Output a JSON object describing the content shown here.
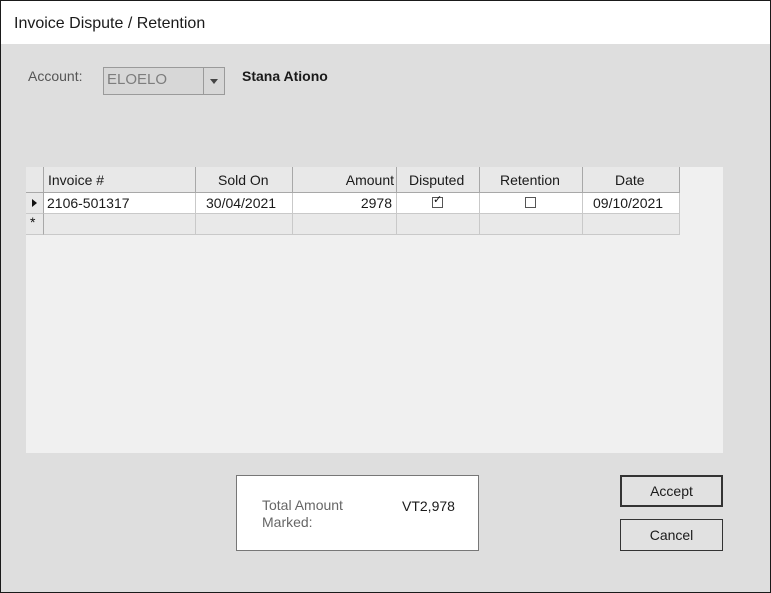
{
  "window": {
    "title": "Invoice Dispute / Retention"
  },
  "account": {
    "label": "Account:",
    "value": "ELOELO",
    "name": "Stana Ationo"
  },
  "grid": {
    "columns": [
      "Invoice #",
      "Sold On",
      "Amount",
      "Disputed",
      "Retention",
      "Date"
    ],
    "rows": [
      {
        "invoice": "2106-501317",
        "sold_on": "30/04/2021",
        "amount": "2978",
        "disputed": true,
        "retention": false,
        "date": "09/10/2021"
      }
    ],
    "new_row_marker": "*"
  },
  "total": {
    "label": "Total Amount Marked:",
    "value": "VT2,978"
  },
  "buttons": {
    "accept": "Accept",
    "cancel": "Cancel"
  }
}
